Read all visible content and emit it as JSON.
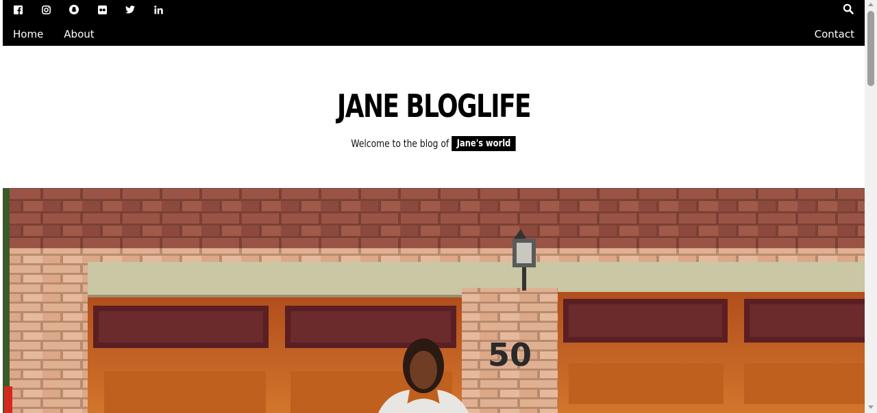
{
  "nav": {
    "social_icons": [
      "facebook-icon",
      "instagram-icon",
      "snapchat-icon",
      "flickr-icon",
      "twitter-icon",
      "linkedin-icon"
    ],
    "links": [
      "Home",
      "About"
    ],
    "contact": "Contact"
  },
  "header": {
    "title": "JANE BLOGLIFE",
    "tagline": "Welcome to the blog of",
    "tagline_badge": "Jane's world"
  },
  "hero": {
    "house_number": "50"
  },
  "colors": {
    "topbar": "#000000",
    "brick": "#8a4a3c",
    "garage_door": "#c8651c"
  }
}
